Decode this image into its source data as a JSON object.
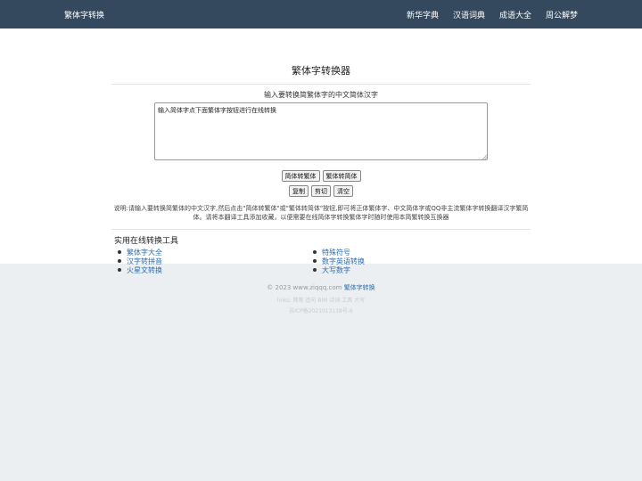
{
  "navbar": {
    "brand": "繁体字转换",
    "links": [
      "新华字典",
      "汉语词典",
      "成语大全",
      "周公解梦"
    ],
    "bg_color": "#34495e"
  },
  "main": {
    "title": "繁体字转换器",
    "prompt": "输入要转换简繁体字的中文简体汉字",
    "textarea_value": "输入简体字点下面繁体字按钮进行在线转换",
    "buttons_row1": [
      "简体转繁体",
      "繁体转简体"
    ],
    "buttons_row2": [
      "复制",
      "剪切",
      "清空"
    ],
    "description": "说明:请输入要转换简繁体的中文汉字,然后点击\"简体转繁体\"或\"繁体转简体\"按钮,即可将正体繁体字、中文简体字或QQ非主流繁体字转换翻译汉字繁简体。请将本翻译工具添加收藏，以便需要在线简体字转换繁体字时随时使用本简繁转换互换器"
  },
  "tools": {
    "heading": "实用在线转换工具",
    "left": [
      "繁体字大全",
      "汉字转拼音",
      "火星文转换"
    ],
    "right": [
      "特殊符号",
      "数字英语转换",
      "大写数字"
    ],
    "link_color": "#2b6cb0"
  },
  "footer": {
    "copyright_prefix": "© 2023 www.ziqqq.com",
    "copyright_link": "繁体字转换",
    "links": "links: 简笔 造句 BMI 诗词 工具 大写",
    "icp": "苏ICP备2021013118号-6"
  }
}
